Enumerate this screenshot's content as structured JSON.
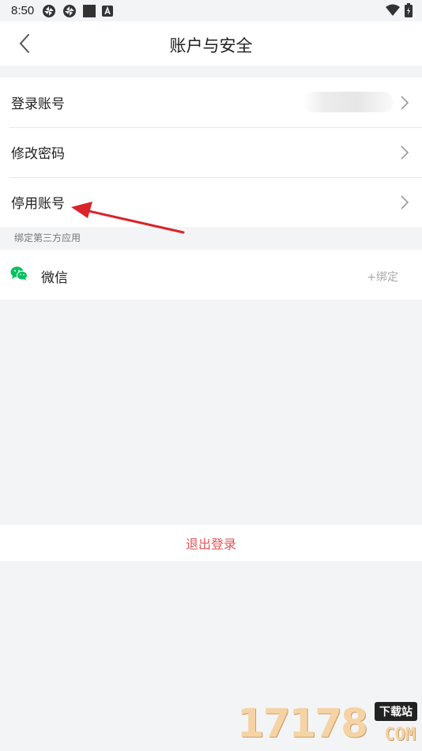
{
  "status_bar": {
    "time": "8:50"
  },
  "header": {
    "title": "账户与安全"
  },
  "account_settings": {
    "items": [
      {
        "label": "登录账号"
      },
      {
        "label": "修改密码"
      },
      {
        "label": "停用账号"
      }
    ]
  },
  "third_party": {
    "section_label": "绑定第三方应用",
    "wechat": {
      "label": "微信",
      "action": "+绑定"
    }
  },
  "logout": {
    "label": "退出登录"
  },
  "annotation": {
    "color": "#d9242b"
  },
  "watermark": {
    "number": "17178",
    "tag": "下载站",
    "domain": "COM"
  },
  "colors": {
    "logout": "#e0575b",
    "wechat": "#07c160",
    "background": "#f3f4f6"
  }
}
